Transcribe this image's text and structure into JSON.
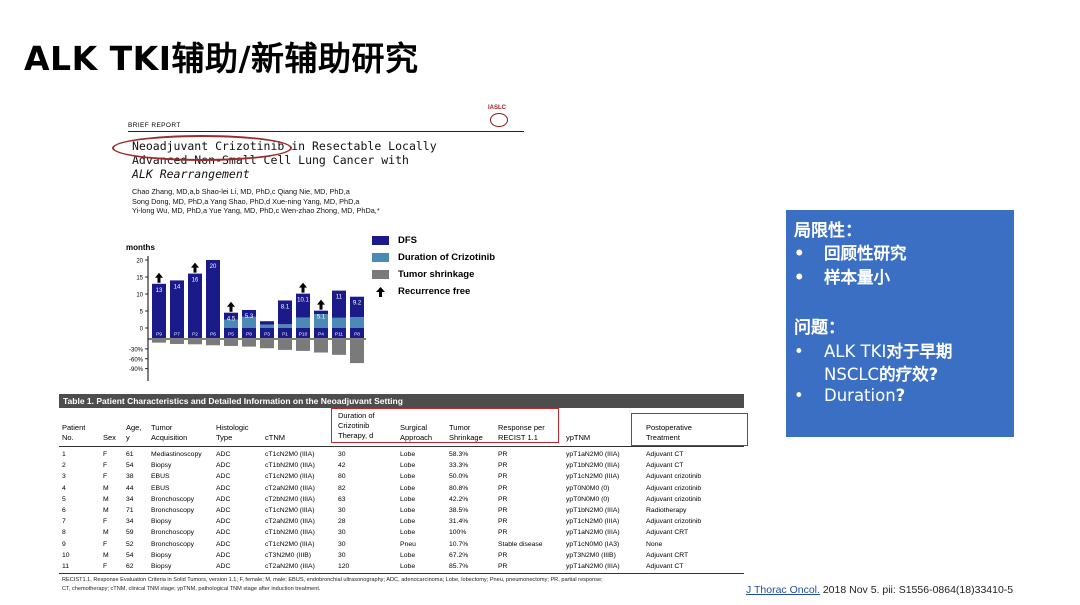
{
  "slide": {
    "title": "ALK TKI辅助/新辅助研究"
  },
  "paper": {
    "section": "BRIEF REPORT",
    "society": "IASLC",
    "title_lines": [
      "Neoadjuvant Crizotinib in Resectable Locally",
      "Advanced Non-Small Cell Lung Cancer with",
      "ALK Rearrangement"
    ],
    "author_lines": [
      "Chao Zhang, MD,a,b Shao-lei Li, MD, PhD,c Qiang Nie, MD, PhD,a",
      "Song Dong, MD, PhD,a Yang Shao, PhD,d Xue-ning Yang, MD, PhD,a",
      "Yi-long Wu, MD, PhD,a Yue Yang, MD, PhD,c Wen-zhao Zhong, MD, PhDa,*"
    ]
  },
  "chart_data": {
    "type": "bar",
    "ylabel": "months",
    "categories": [
      "P9",
      "P7",
      "P2",
      "P6",
      "P5",
      "P8",
      "P3",
      "P1",
      "P10",
      "P4",
      "P11",
      "P8"
    ],
    "yticks_top": [
      "20",
      "15",
      "10",
      "5",
      "0"
    ],
    "yticks_bottom": [
      "-30%",
      "-60%",
      "-90%"
    ],
    "series": [
      {
        "name": "DFS",
        "values": [
          13,
          14,
          16,
          20,
          2,
          2,
          1,
          7,
          7,
          1,
          8,
          6
        ]
      },
      {
        "name": "Duration of Crizotinib",
        "values": [
          0,
          0,
          0,
          0,
          2.5,
          3.3,
          1,
          1.1,
          3.1,
          4.1,
          3,
          3.2
        ]
      }
    ],
    "labels": [
      "13",
      "14",
      "16",
      "20",
      "4.5",
      "5.3",
      "",
      "8.1",
      "10.1",
      "5.1",
      "11",
      "9.2"
    ],
    "tumor_shrinkage_pct": [
      -8,
      -12,
      -13,
      -16,
      -18,
      -20,
      -25,
      -30,
      -33,
      -38,
      -45,
      -70
    ],
    "recurrence_free": [
      true,
      false,
      true,
      false,
      true,
      false,
      false,
      false,
      true,
      true,
      false,
      false
    ],
    "legend": [
      "DFS",
      "Duration of Crizotinib",
      "Tumor shrinkage",
      "Recurrence free"
    ],
    "colors": {
      "dfs": "#1a1a8a",
      "duration": "#4a8ab5",
      "shrink": "#7a7a7a"
    }
  },
  "table": {
    "title": "Table 1. Patient Characteristics and Detailed Information on the Neoadjuvant Setting",
    "headers": [
      [
        "Patient",
        "No."
      ],
      [
        "",
        "Sex"
      ],
      [
        "Age,",
        "y"
      ],
      [
        "Tumor",
        "Acquisition"
      ],
      [
        "Histologic",
        "Type"
      ],
      [
        "",
        "cTNM"
      ],
      [
        "Duration of",
        "Crizotinib",
        "Therapy, d"
      ],
      [
        "Surgical",
        "Approach"
      ],
      [
        "Tumor",
        "Shrinkage"
      ],
      [
        "Response per",
        "RECIST 1.1"
      ],
      [
        "",
        "ypTNM"
      ],
      [
        "Postoperative",
        "Treatment"
      ]
    ],
    "rows": [
      [
        "1",
        "F",
        "61",
        "Mediastinoscopy",
        "ADC",
        "cT1cN2M0 (IIIA)",
        "30",
        "Lobe",
        "58.3%",
        "PR",
        "ypT1aN2M0 (IIIA)",
        "Adjuvant CT"
      ],
      [
        "2",
        "F",
        "54",
        "Biopsy",
        "ADC",
        "cT1bN2M0 (IIIA)",
        "42",
        "Lobe",
        "33.3%",
        "PR",
        "ypT1bN2M0 (IIIA)",
        "Adjuvant CT"
      ],
      [
        "3",
        "F",
        "38",
        "EBUS",
        "ADC",
        "cT1cN2M0 (IIIA)",
        "80",
        "Lobe",
        "50.0%",
        "PR",
        "ypT1cN2M0 (IIIA)",
        "Adjuvant crizotinib"
      ],
      [
        "4",
        "M",
        "44",
        "EBUS",
        "ADC",
        "cT2aN2M0 (IIIA)",
        "82",
        "Lobe",
        "80.8%",
        "PR",
        "ypT0N0M0 (0)",
        "Adjuvant crizotinib"
      ],
      [
        "5",
        "M",
        "34",
        "Bronchoscopy",
        "ADC",
        "cT2bN2M0 (IIIA)",
        "63",
        "Lobe",
        "42.2%",
        "PR",
        "ypT0N0M0 (0)",
        "Adjuvant crizotinib"
      ],
      [
        "6",
        "M",
        "71",
        "Bronchoscopy",
        "ADC",
        "cT1cN2M0 (IIIA)",
        "30",
        "Lobe",
        "38.5%",
        "PR",
        "ypT1bN2M0 (IIIA)",
        "Radiotherapy"
      ],
      [
        "7",
        "F",
        "34",
        "Biopsy",
        "ADC",
        "cT2aN2M0 (IIIA)",
        "28",
        "Lobe",
        "31.4%",
        "PR",
        "ypT1cN2M0 (IIIA)",
        "Adjuvant crizotinib"
      ],
      [
        "8",
        "M",
        "59",
        "Bronchoscopy",
        "ADC",
        "cT1bN2M0 (IIIA)",
        "30",
        "Lobe",
        "100%",
        "PR",
        "ypT1aN2M0 (IIIA)",
        "Adjuvant CRT"
      ],
      [
        "9",
        "F",
        "52",
        "Bronchoscopy",
        "ADC",
        "cT1cN2M0 (IIIA)",
        "30",
        "Pneu",
        "10.7%",
        "Stable disease",
        "ypT1cN0M0 (IA3)",
        "None"
      ],
      [
        "10",
        "M",
        "54",
        "Biopsy",
        "ADC",
        "cT3N2M0 (IIIB)",
        "30",
        "Lobe",
        "67.2%",
        "PR",
        "ypT3N2M0 (IIIB)",
        "Adjuvant CRT"
      ],
      [
        "11",
        "F",
        "62",
        "Biopsy",
        "ADC",
        "cT2aN2M0 (IIIA)",
        "120",
        "Lobe",
        "85.7%",
        "PR",
        "ypT1aN2M0 (IIIA)",
        "Adjuvant CT"
      ]
    ],
    "footnote_lines": [
      "RECIST1.1, Response Evaluation Criteria in Solid Tumors, version 1.1; F, female; M, male; EBUS, endobronchial ultrasonography; ADC, adenocarcinoma; Lobe, lobectomy; Pneu, pneumonectomy; PR, partial response;",
      "CT, chemotherapy; cTNM, clinical TNM stage; ypTNM, pathological TNM stage after induction treatment."
    ]
  },
  "citation": {
    "journal": "J Thorac Oncol.",
    "rest": " 2018 Nov 5. pii: S1556-0864(18)33410-5"
  },
  "sidebox": {
    "limitations_title": "局限性：",
    "limitations": [
      "回顾性研究",
      "样本量小"
    ],
    "questions_title": "问题：",
    "q1_line1_prefix": "ALK TKI",
    "q1_line1_bold": "对于早期",
    "q1_line2_prefix": "NSCLC",
    "q1_line2_bold": "的疗效?",
    "q2_prefix": "Duration",
    "q2_bold": "?",
    "bullet": "•",
    "color": "#3a6fc4"
  }
}
